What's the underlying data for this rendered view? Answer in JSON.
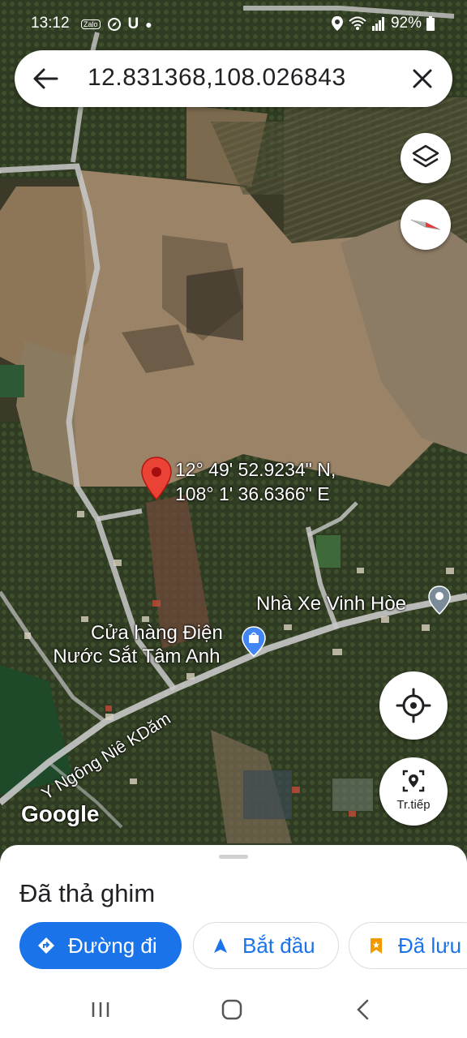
{
  "status_bar": {
    "time": "13:12",
    "left_icons": [
      "zalo-icon",
      "browser-icon",
      "u-icon",
      "dot-icon"
    ],
    "battery": "92%"
  },
  "search": {
    "query": "12.831368,108.026843"
  },
  "pin": {
    "coords_line1": "12° 49' 52.9234\" N,",
    "coords_line2": "108° 1' 36.6366\" E"
  },
  "map_labels": {
    "bus": "Nhà Xe Vinh Hòe",
    "shop_line1": "Cửa hàng Điện",
    "shop_line2": "Nước Sắt Tâm Anh",
    "road": "Y Ngông Niê KDăm",
    "attribution": "Google"
  },
  "controls": {
    "live_label": "Tr.tiếp"
  },
  "sheet": {
    "title": "Đã thả ghim",
    "actions": [
      {
        "label": "Đường đi",
        "icon": "directions-icon"
      },
      {
        "label": "Bắt đầu",
        "icon": "navigate-arrow-icon"
      },
      {
        "label": "Đã lưu",
        "icon": "bookmark-icon"
      }
    ]
  },
  "colors": {
    "accent": "#1a73e8",
    "pin": "#ea4335",
    "sheet": "#ffffff"
  }
}
